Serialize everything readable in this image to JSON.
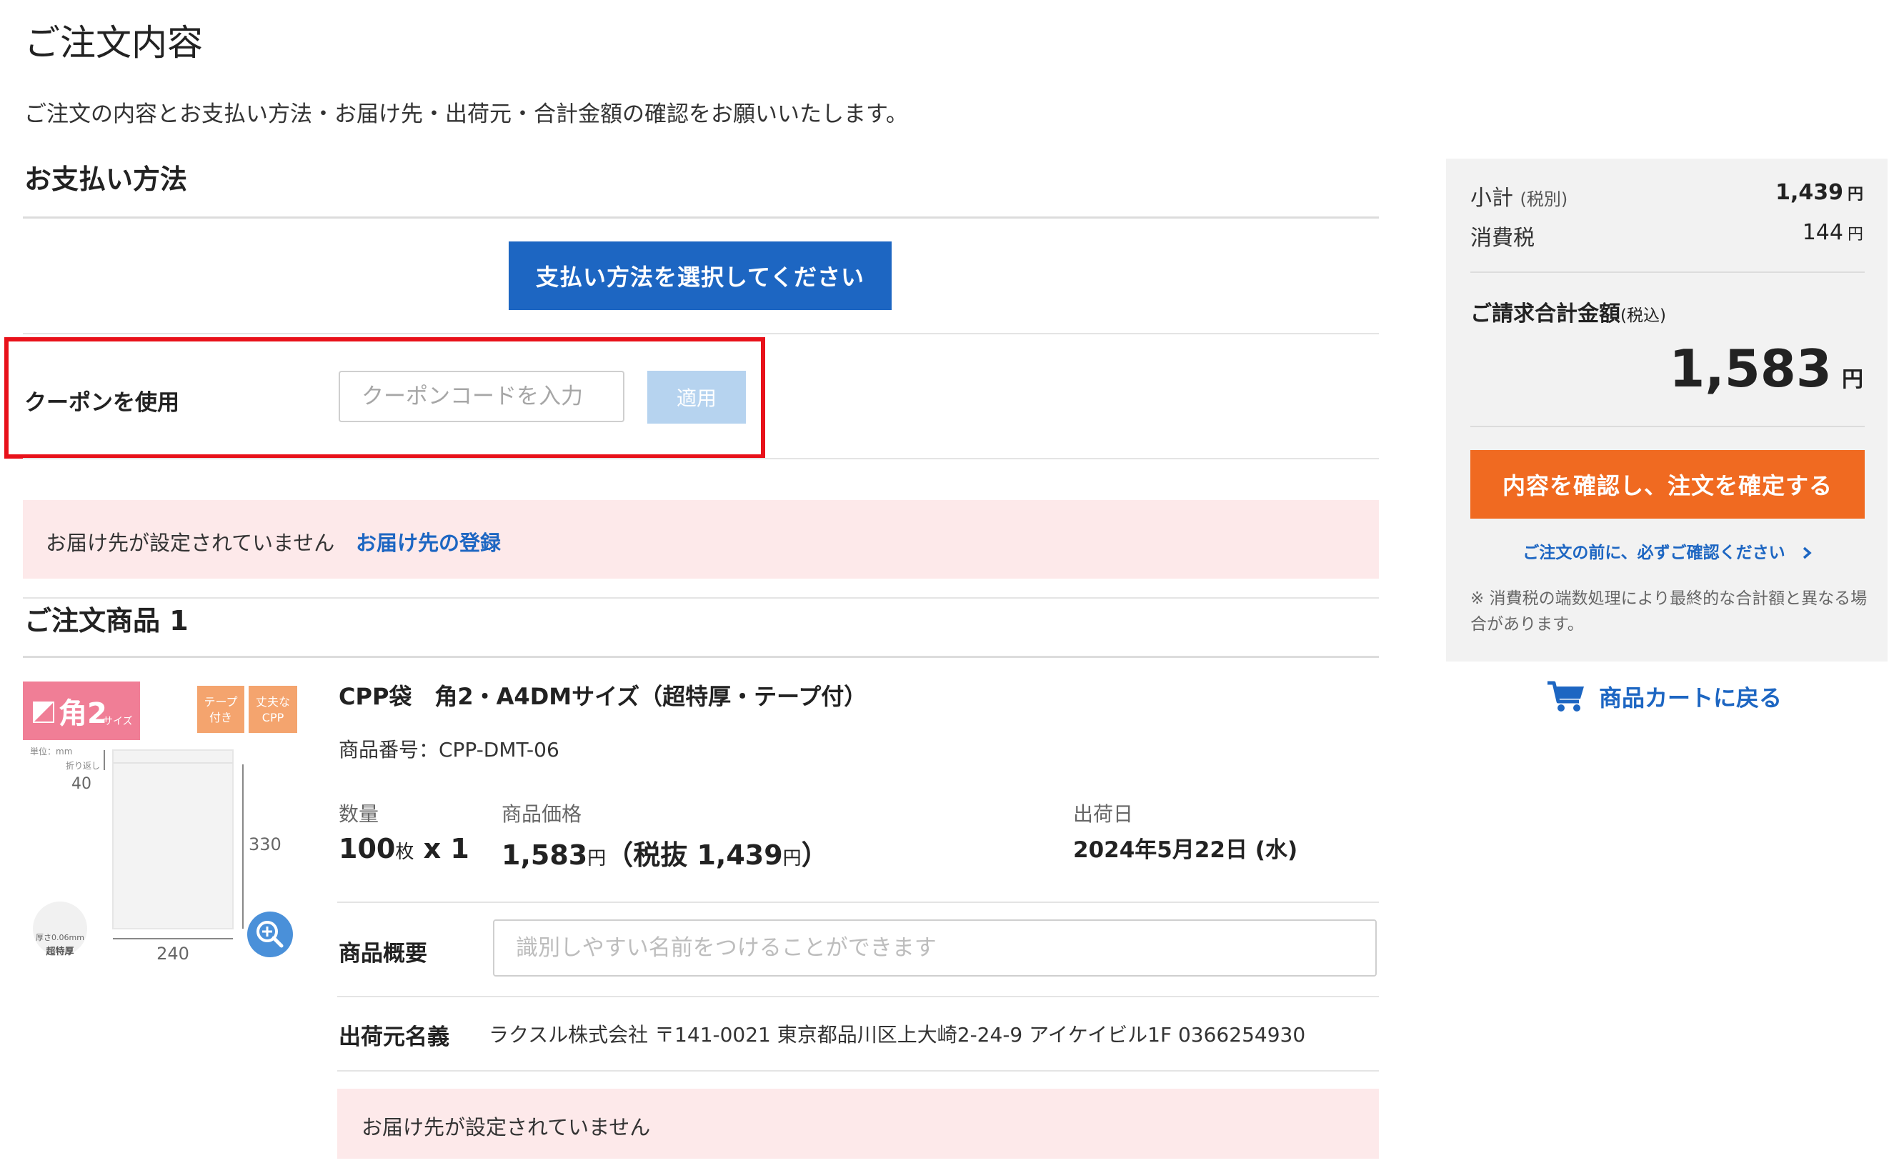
{
  "page": {
    "title": "ご注文内容",
    "intro": "ご注文の内容とお支払い方法・お届け先・出荷元・合計金額の確認をお願いいたします。"
  },
  "payment": {
    "heading": "お支払い方法",
    "select_button": "支払い方法を選択してください"
  },
  "coupon": {
    "label": "クーポンを使用",
    "placeholder": "クーポンコードを入力",
    "apply_button": "適用"
  },
  "delivery_alert": {
    "text": "お届け先が設定されていません",
    "link": "お届け先の登録"
  },
  "order_item": {
    "heading": "ご注文商品 1",
    "name": "CPP袋　角2・A4DMサイズ（超特厚・テープ付）",
    "code": "商品番号：CPP-DMT-06",
    "quantity_label": "数量",
    "quantity_num": "100",
    "quantity_unit": "枚",
    "quantity_mult": " x 1",
    "price_label": "商品価格",
    "price_value": "1,583",
    "price_unit": "円",
    "price_tax_prefix": "（税抜 1,439",
    "price_tax_suffix": "）",
    "ship_date_label": "出荷日",
    "ship_date": "2024年5月22日 (水)",
    "summary_label": "商品概要",
    "summary_placeholder": "識別しやすい名前をつけることができます",
    "shipper_label": "出荷元名義",
    "shipper_value": "ラクスル株式会社 〒141-0021 東京都品川区上大崎2-24-9 アイケイビル1F 0366254930",
    "alert_text": "お届け先が設定されていません",
    "image": {
      "size_badge": "角2",
      "size_badge_sub": "サイズ",
      "tag_tape_1": "テープ",
      "tag_tape_2": "付き",
      "tag_strong_1": "丈夫な",
      "tag_strong_2": "CPP",
      "unit_note": "単位：mm",
      "flap_note": "折り返し",
      "flap": "40",
      "height": "330",
      "width": "240",
      "thickness_note": "厚さ0.06mm",
      "thickness_label": "超特厚"
    }
  },
  "summary": {
    "subtotal_label": "小計",
    "subtotal_note": "(税別)",
    "subtotal_value": "1,439",
    "tax_label": "消費税",
    "tax_value": "144",
    "yen": "円",
    "total_label": "ご請求合計金額",
    "total_note": "(税込)",
    "total_value": "1,583",
    "confirm_button": "内容を確認し、注文を確定する",
    "check_link": "ご注文の前に、必ずご確認ください",
    "notice": "※ 消費税の端数処理により最終的な合計額と異なる場合があります。"
  },
  "cart_link": "商品カートに戻る",
  "colors": {
    "primary_blue": "#1d66c2",
    "confirm_orange": "#f06a21",
    "alert_bg": "#fde9ea",
    "highlight_red": "#e8111a",
    "summary_bg": "#f2f2f2"
  },
  "icons": {
    "cart": "cart-icon",
    "chevron": "chevron-right-icon",
    "zoom": "zoom-in-icon"
  }
}
